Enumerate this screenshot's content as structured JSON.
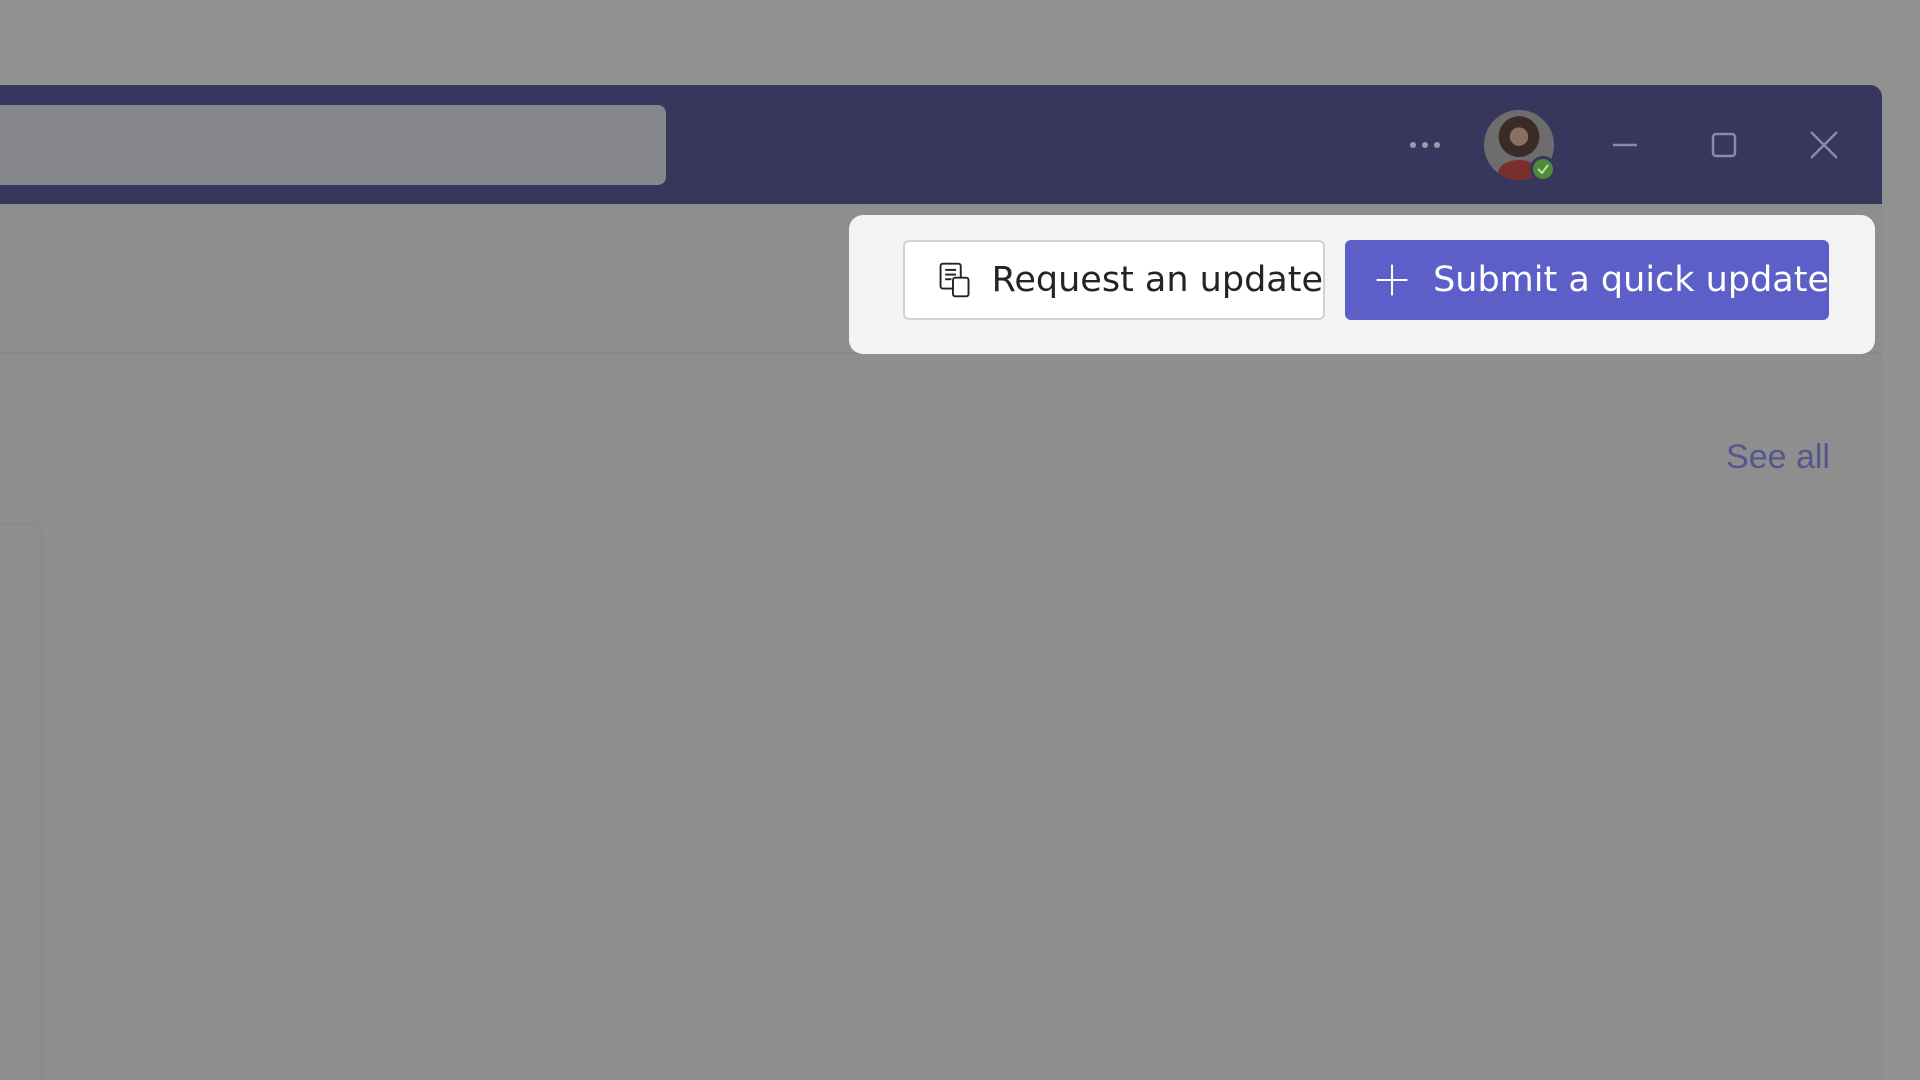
{
  "app": {
    "accent_color": "#5b5fc7",
    "titlebar_color": "#37375e"
  },
  "titlebar": {
    "search_placeholder": "",
    "more_icon": "more-horizontal-icon",
    "avatar_status": "available",
    "window_controls": [
      "minimize-icon",
      "maximize-icon",
      "close-icon"
    ]
  },
  "content": {
    "see_all_label": "See all"
  },
  "actions": {
    "request_update": {
      "label": "Request an update",
      "icon": "copy-clipboard-icon"
    },
    "quick_update": {
      "label": "Submit a quick update",
      "icon": "plus-icon"
    }
  }
}
